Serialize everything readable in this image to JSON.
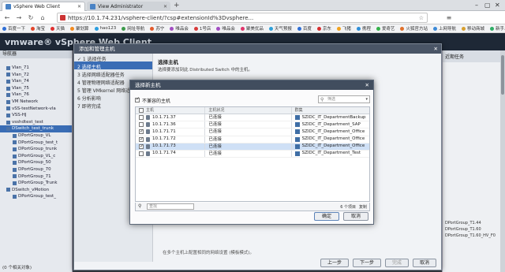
{
  "browser": {
    "tabs": [
      {
        "label": "vSphere Web Client",
        "active": true
      },
      {
        "label": "View Administrator",
        "active": false
      }
    ],
    "url": "https://10.1.74.231/vsphere-client/?csp#extensionId%3Dvsphere...",
    "bookmarks": [
      "百度一下",
      "淘宝",
      "天猫",
      "聚划算",
      "hao123",
      "网址导航",
      "苏宁",
      "唯品会",
      "1号店",
      "唯品会",
      "聚美优品",
      "天气预报",
      "百度",
      "京东",
      "飞猪",
      "携程",
      "爱奇艺",
      "火狐官方站",
      "上网导航",
      "移动商城",
      "新手上路",
      "驱动精灵"
    ]
  },
  "app": {
    "logo": "vmware® vSphere Web Client",
    "navigator": {
      "title": "导航器",
      "items": [
        {
          "label": "Vlan_71",
          "indent": false
        },
        {
          "label": "Vlan_72",
          "indent": false
        },
        {
          "label": "Vlan_74",
          "indent": false
        },
        {
          "label": "Vlan_75",
          "indent": false
        },
        {
          "label": "Vlan_76",
          "indent": false
        },
        {
          "label": "VM Network",
          "indent": false
        },
        {
          "label": "vSS-testNetwork-vla",
          "indent": false
        },
        {
          "label": "VSS-HJ",
          "indent": false
        },
        {
          "label": "vsshdtest_test",
          "indent": false
        },
        {
          "label": "DSwitch_test_trunk",
          "indent": false,
          "selected": true
        },
        {
          "label": "DPortGroup_VL",
          "indent": true
        },
        {
          "label": "DPortGroup_test_t",
          "indent": true
        },
        {
          "label": "DPortGroup_trunk",
          "indent": true
        },
        {
          "label": "DPortGroup_VL_c",
          "indent": true
        },
        {
          "label": "DPortGroup_50",
          "indent": true
        },
        {
          "label": "DPortGroup_70",
          "indent": true
        },
        {
          "label": "DPortGroup_71",
          "indent": true
        },
        {
          "label": "DPortGroup_Trunk",
          "indent": true
        },
        {
          "label": "DSwitch_vMotion",
          "indent": false
        },
        {
          "label": "DPortGroup_test_",
          "indent": true
        }
      ],
      "footer": "(0 个相关对象)"
    },
    "right_panel": {
      "title": "近期任务",
      "items": [
        "DPortGroup_T1.44",
        "DPortGroup_T1.60",
        "DPortGroup_T1.60_HV_F0"
      ]
    }
  },
  "wizard": {
    "title": "添加和管理主机",
    "steps": [
      {
        "label": "✓ 1 选择任务",
        "active": false
      },
      {
        "label": "2 选择主机",
        "active": true
      },
      {
        "label": "3 选择网络适配器任务",
        "active": false
      },
      {
        "label": "4 管理物理网络适配器",
        "active": false
      },
      {
        "label": "5 管理 VMkernel 网络适配器",
        "active": false
      },
      {
        "label": "6 分析影响",
        "active": false
      },
      {
        "label": "7 即将完成",
        "active": false
      }
    ],
    "heading": "选择主机",
    "subheading": "选择要添加到此 Distributed Switch 中的主机。",
    "footer_text": "在多个主机上配置相同的网络设置 (模板模式)。",
    "buttons": {
      "back": "上一步",
      "next": "下一步",
      "finish": "完成",
      "cancel": "取消"
    }
  },
  "dialog": {
    "title": "选择新主机",
    "incompatible_label": "不兼容的主机",
    "filter_placeholder": "筛选",
    "columns": [
      "主机",
      "主机状况",
      "群集"
    ],
    "rows": [
      {
        "host": "10.1.71.37",
        "state": "已连接",
        "cluster": "SZIDC_IT_DepartmentBackup",
        "checked": false,
        "selected": false
      },
      {
        "host": "10.1.71.36",
        "state": "已连接",
        "cluster": "SZIDC_IT_Department_SAP",
        "checked": false,
        "selected": false
      },
      {
        "host": "10.1.71.71",
        "state": "已连接",
        "cluster": "SZIDC_IT_Department_Office",
        "checked": true,
        "selected": false
      },
      {
        "host": "10.1.71.72",
        "state": "已连接",
        "cluster": "SZIDC_IT_Department_Office",
        "checked": true,
        "selected": false
      },
      {
        "host": "10.1.71.73",
        "state": "已连接",
        "cluster": "SZIDC_IT_Department_Office",
        "checked": true,
        "selected": true
      },
      {
        "host": "10.1.71.74",
        "state": "已连接",
        "cluster": "SZIDC_IT_Department_Test",
        "checked": false,
        "selected": false
      }
    ],
    "find_placeholder": "查找",
    "count": "6 个项目",
    "copy": "复制",
    "buttons": {
      "ok": "确定",
      "cancel": "取消"
    }
  }
}
